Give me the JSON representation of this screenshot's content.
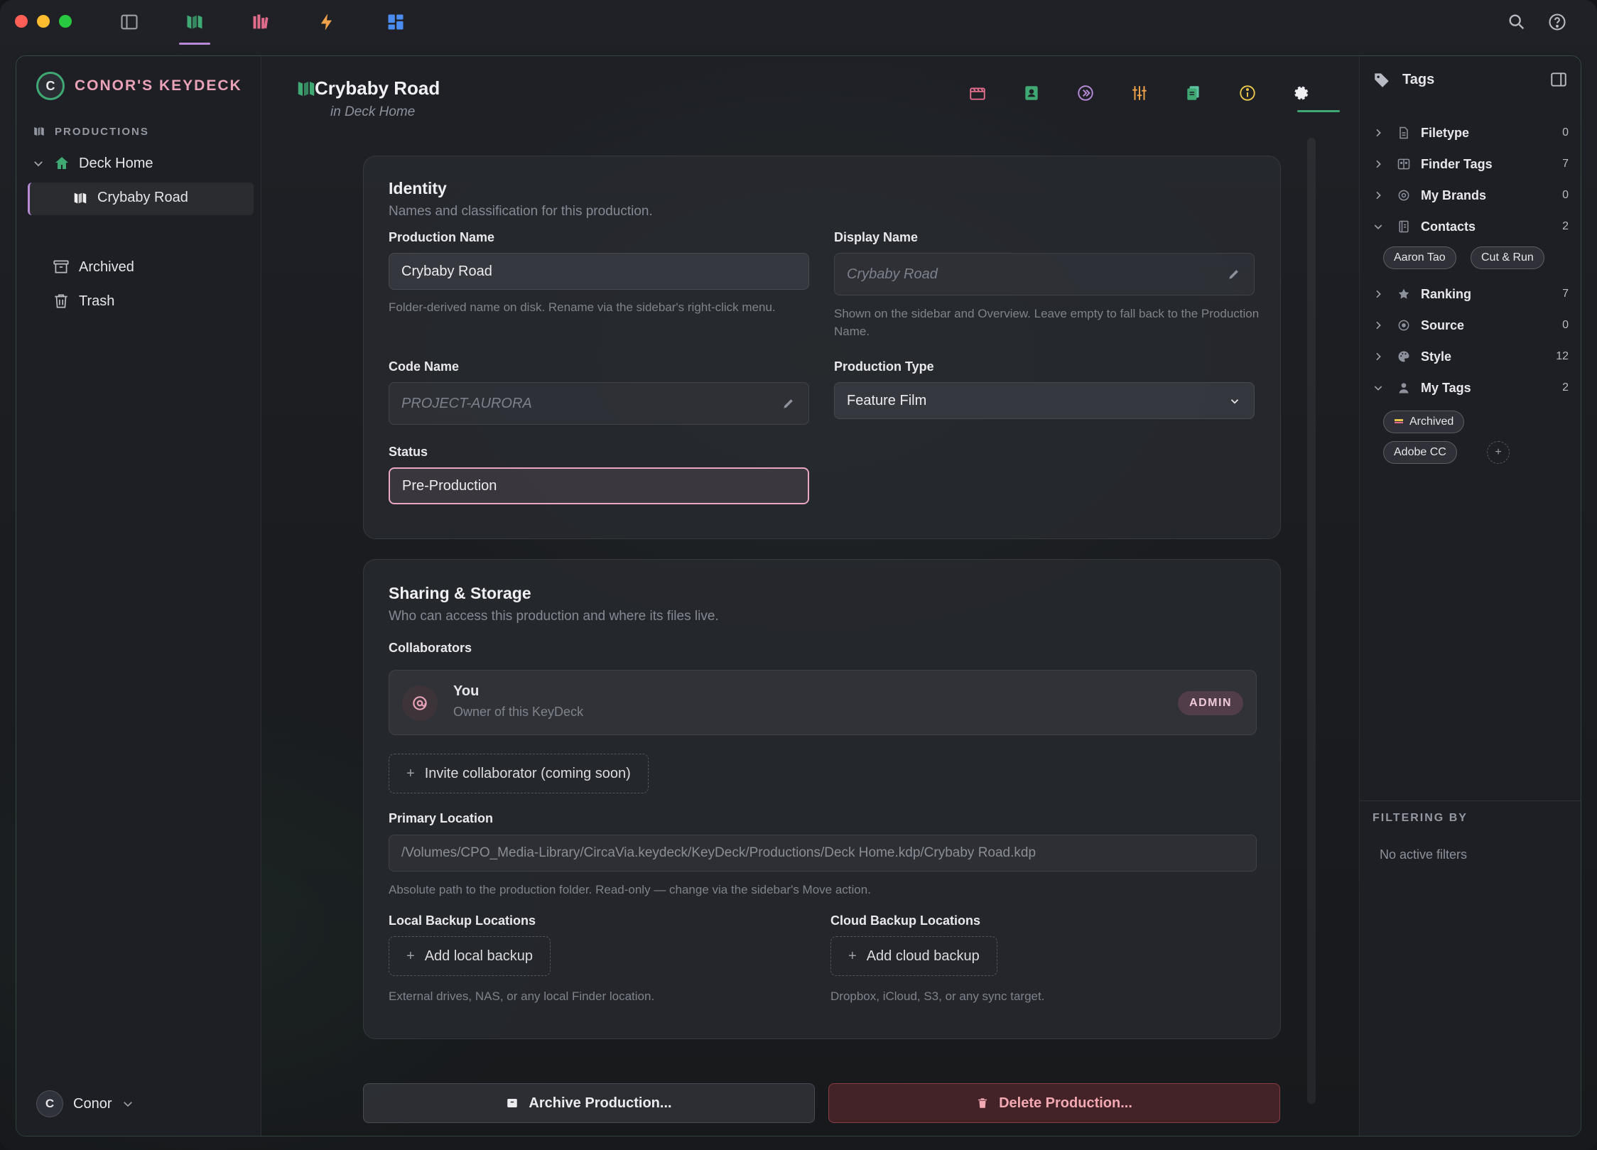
{
  "app": {
    "brand": "CONOR'S KEYDECK",
    "brand_initial": "C",
    "accent": "#3fa873",
    "pink": "#e9a2b8"
  },
  "sidebar": {
    "section": "PRODUCTIONS",
    "tree": [
      {
        "label": "Deck Home"
      },
      {
        "label": "Crybaby Road"
      }
    ],
    "archived": "Archived",
    "trash": "Trash",
    "user": {
      "initial": "C",
      "name": "Conor"
    }
  },
  "header": {
    "title": "Crybaby Road",
    "subtitle": "in Deck Home"
  },
  "identity": {
    "title": "Identity",
    "subtitle": "Names and classification for this production.",
    "production_name_label": "Production Name",
    "production_name_value": "Crybaby Road",
    "production_name_hint": "Folder-derived name on disk. Rename via the sidebar's right-click menu.",
    "display_name_label": "Display Name",
    "display_name_placeholder": "Crybaby Road",
    "display_name_hint": "Shown on the sidebar and Overview. Leave empty to fall back to the Production Name.",
    "code_name_label": "Code Name",
    "code_name_placeholder": "PROJECT-AURORA",
    "production_type_label": "Production Type",
    "production_type_value": "Feature Film",
    "status_label": "Status",
    "status_value": "Pre-Production"
  },
  "sharing": {
    "title": "Sharing & Storage",
    "subtitle": "Who can access this production and where its files live.",
    "collaborators_label": "Collaborators",
    "collaborator": {
      "name": "You",
      "role": "Owner of this KeyDeck",
      "badge": "ADMIN"
    },
    "invite_label": "Invite collaborator (coming soon)",
    "primary_location_label": "Primary Location",
    "primary_location_value": "/Volumes/CPO_Media-Library/CircaVia.keydeck/KeyDeck/Productions/Deck Home.kdp/Crybaby Road.kdp",
    "primary_location_hint": "Absolute path to the production folder. Read-only — change via the sidebar's Move action.",
    "local_backup_label": "Local Backup Locations",
    "local_backup_button": "Add local backup",
    "local_backup_hint": "External drives, NAS, or any local Finder location.",
    "cloud_backup_label": "Cloud Backup Locations",
    "cloud_backup_button": "Add cloud backup",
    "cloud_backup_hint": "Dropbox, iCloud, S3, or any sync target."
  },
  "actions": {
    "archive": "Archive Production...",
    "delete": "Delete Production..."
  },
  "tags_panel": {
    "title": "Tags",
    "categories": [
      {
        "label": "Filetype",
        "count": "0",
        "expanded": false
      },
      {
        "label": "Finder Tags",
        "count": "7",
        "expanded": false
      },
      {
        "label": "My Brands",
        "count": "0",
        "expanded": false
      },
      {
        "label": "Contacts",
        "count": "2",
        "expanded": true
      },
      {
        "label": "Ranking",
        "count": "7",
        "expanded": false
      },
      {
        "label": "Source",
        "count": "0",
        "expanded": false
      },
      {
        "label": "Style",
        "count": "12",
        "expanded": false
      },
      {
        "label": "My Tags",
        "count": "2",
        "expanded": true
      }
    ],
    "contacts_pills": [
      "Aaron Tao",
      "Cut & Run"
    ],
    "my_tags_pills": [
      "Archived",
      "Adobe CC"
    ],
    "add_pill": "+",
    "filtering_label": "FILTERING BY",
    "filtering_empty": "No active filters"
  }
}
